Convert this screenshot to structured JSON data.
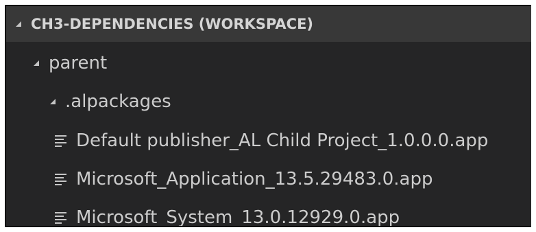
{
  "explorer": {
    "workspace_title": "CH3-DEPENDENCIES (WORKSPACE)",
    "tree": {
      "folder_parent": "parent",
      "folder_alpackages": ".alpackages",
      "files": [
        "Default publisher_AL Child Project_1.0.0.0.app",
        "Microsoft_Application_13.5.29483.0.app",
        "Microsoft_System_13.0.12929.0.app"
      ]
    }
  },
  "icons": {
    "expanded": "chevron-expanded-icon",
    "file": "file-lines-icon"
  }
}
